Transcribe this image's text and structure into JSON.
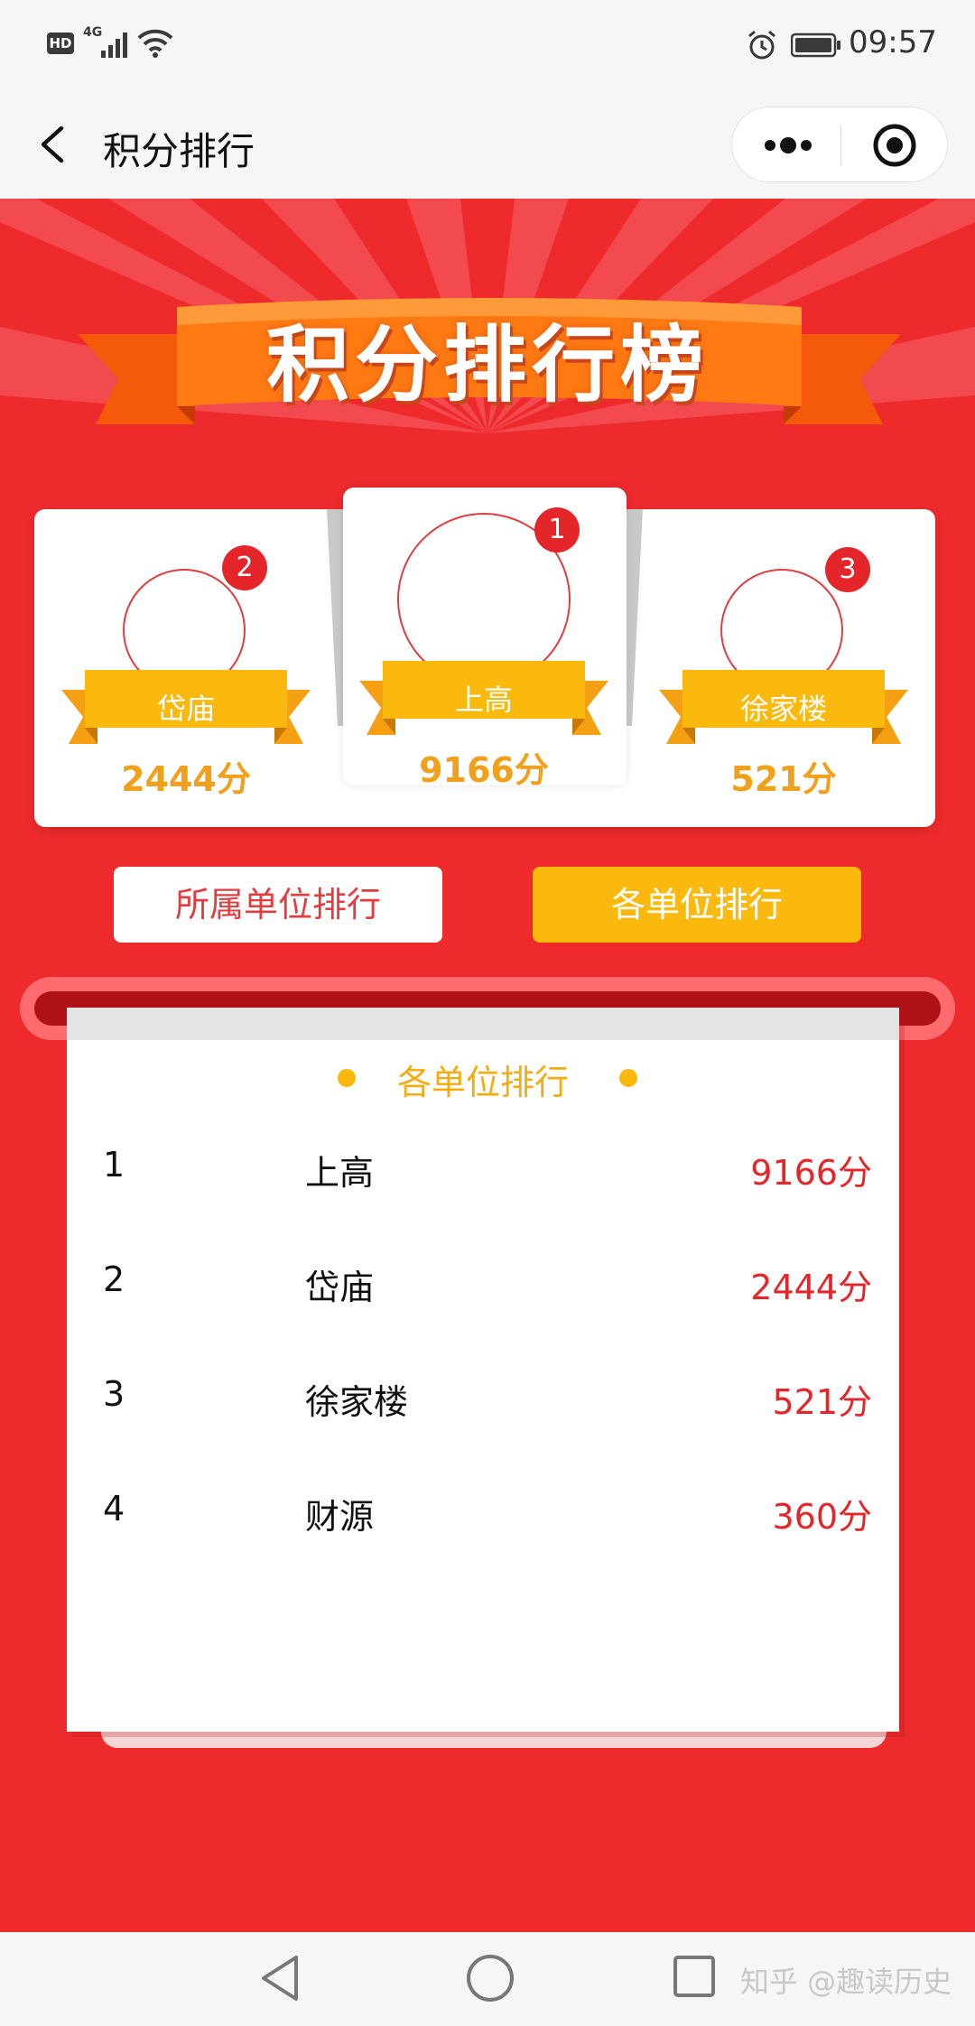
{
  "status_bar": {
    "hd_label": "HD",
    "network_label": "4G",
    "time": "09:57"
  },
  "nav": {
    "title": "积分排行"
  },
  "banner": {
    "title": "积分排行榜",
    "colors": {
      "ribbon": "#ff7a13",
      "ribbon_dark": "#f45a0a"
    }
  },
  "podium": [
    {
      "rank": "2",
      "name": "岱庙",
      "score": "2444分"
    },
    {
      "rank": "1",
      "name": "上高",
      "score": "9166分"
    },
    {
      "rank": "3",
      "name": "徐家楼",
      "score": "521分"
    }
  ],
  "tabs": {
    "own_unit": "所属单位排行",
    "all_units": "各单位排行",
    "active": "all_units"
  },
  "ranking_list": {
    "title": "各单位排行",
    "rows": [
      {
        "rank": "1",
        "name": "上高",
        "score": "9166分"
      },
      {
        "rank": "2",
        "name": "岱庙",
        "score": "2444分"
      },
      {
        "rank": "3",
        "name": "徐家楼",
        "score": "521分"
      },
      {
        "rank": "4",
        "name": "财源",
        "score": "360分"
      }
    ]
  },
  "watermark": "知乎 @趣读历史",
  "colors": {
    "background_red": "#ee2a2d",
    "accent_yellow": "#fbb80d",
    "score_red": "#e4262b",
    "score_gold": "#f0a01a"
  },
  "icons": [
    "back-arrow-icon",
    "more-dots-icon",
    "close-target-icon",
    "alarm-icon",
    "battery-icon",
    "signal-icon",
    "wifi-icon",
    "system-back-icon",
    "system-home-icon",
    "system-recent-icon"
  ]
}
